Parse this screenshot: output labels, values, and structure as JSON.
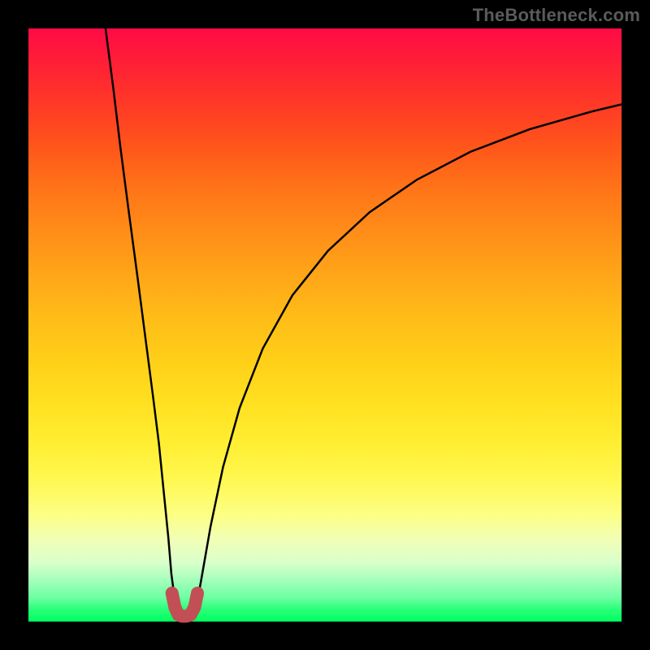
{
  "watermark": "TheBottleneck.com",
  "chart_data": {
    "type": "line",
    "title": "",
    "xlabel": "",
    "ylabel": "",
    "xlim": [
      0,
      100
    ],
    "ylim": [
      0,
      100
    ],
    "series": [
      {
        "name": "left-branch",
        "x": [
          13.0,
          14.3,
          15.5,
          16.8,
          18.4,
          19.7,
          21.0,
          22.0,
          22.8,
          23.6,
          24.1,
          24.7
        ],
        "y": [
          100.0,
          90.0,
          80.0,
          70.0,
          58.0,
          48.0,
          38.0,
          30.0,
          22.0,
          14.0,
          8.0,
          3.5
        ]
      },
      {
        "name": "right-branch",
        "x": [
          28.5,
          29.3,
          30.7,
          32.8,
          35.6,
          39.5,
          44.5,
          50.5,
          57.5,
          65.5,
          74.5,
          84.5,
          95.0,
          100.0
        ],
        "y": [
          3.5,
          8.0,
          16.0,
          26.0,
          36.0,
          46.0,
          55.0,
          62.5,
          69.0,
          74.5,
          79.2,
          83.0,
          86.0,
          87.2
        ]
      },
      {
        "name": "bottom-bump",
        "x": [
          24.2,
          24.7,
          25.3,
          25.9,
          26.6,
          27.3,
          28.0,
          28.5
        ],
        "y": [
          4.8,
          2.4,
          1.1,
          0.9,
          0.9,
          1.1,
          2.4,
          4.8
        ]
      }
    ],
    "colors": {
      "curve": "#000000",
      "bump": "#c14f55",
      "gradient_top": "#ff0a46",
      "gradient_bottom": "#00ff60"
    }
  }
}
